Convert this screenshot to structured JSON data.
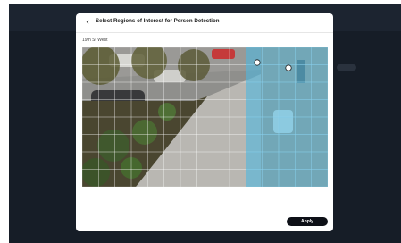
{
  "modal": {
    "back_icon": "chevron-left-icon",
    "back_glyph": "‹",
    "title": "Select Regions of Interest for Person Detection",
    "camera_name": "19th St West",
    "apply_label": "Apply"
  },
  "grid": {
    "columns": 15,
    "rows": 8,
    "selected_color": "#4fb7df",
    "selected_cells": [
      [
        0,
        10
      ],
      [
        0,
        11
      ],
      [
        0,
        12
      ],
      [
        0,
        13
      ],
      [
        0,
        14
      ],
      [
        1,
        10
      ],
      [
        1,
        11
      ],
      [
        1,
        12
      ],
      [
        1,
        13
      ],
      [
        1,
        14
      ],
      [
        2,
        10
      ],
      [
        2,
        11
      ],
      [
        2,
        12
      ],
      [
        2,
        13
      ],
      [
        2,
        14
      ],
      [
        3,
        10
      ],
      [
        3,
        11
      ],
      [
        3,
        12
      ],
      [
        3,
        13
      ],
      [
        3,
        14
      ],
      [
        4,
        10
      ],
      [
        4,
        11
      ],
      [
        4,
        12
      ],
      [
        4,
        13
      ],
      [
        4,
        14
      ],
      [
        5,
        10
      ],
      [
        5,
        11
      ],
      [
        5,
        12
      ],
      [
        5,
        13
      ],
      [
        5,
        14
      ],
      [
        6,
        10
      ],
      [
        6,
        11
      ],
      [
        6,
        12
      ],
      [
        6,
        13
      ],
      [
        6,
        14
      ],
      [
        7,
        10
      ],
      [
        7,
        11
      ],
      [
        7,
        12
      ],
      [
        7,
        13
      ],
      [
        7,
        14
      ]
    ]
  },
  "colors": {
    "backdrop": "#161d27",
    "apply_button": "#0d1017"
  }
}
